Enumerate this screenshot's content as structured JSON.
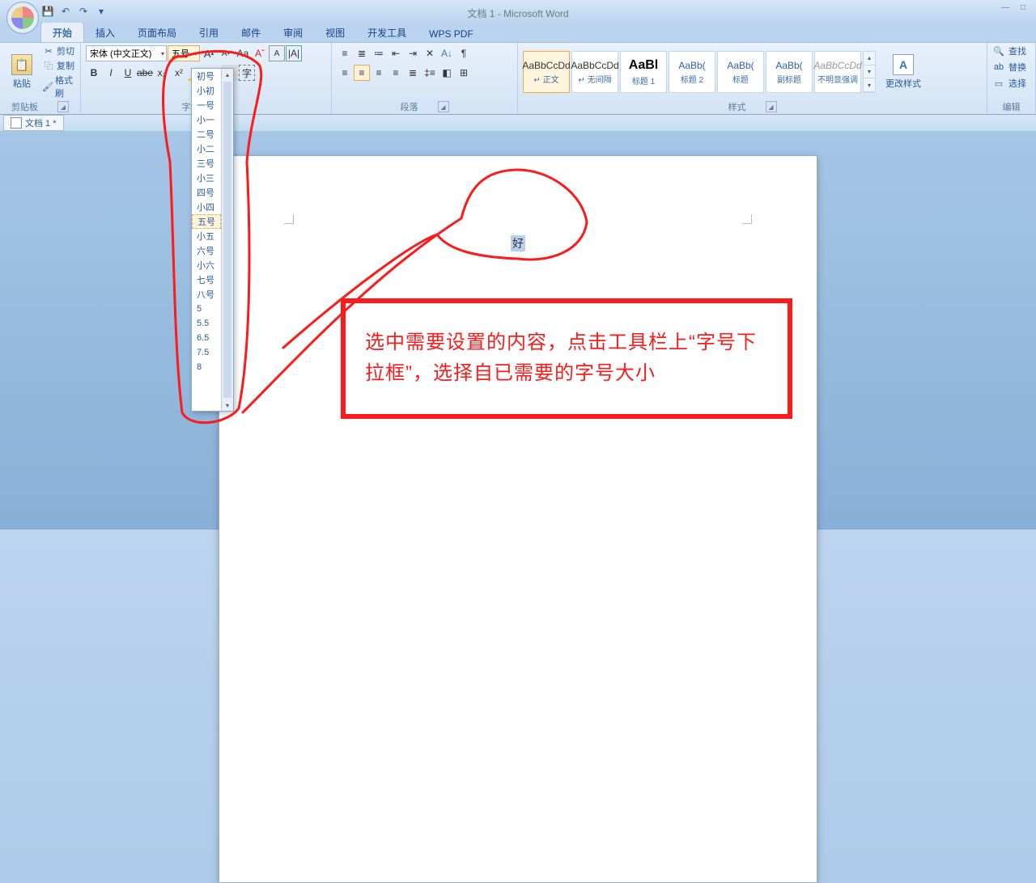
{
  "app": {
    "title": "文档 1 - Microsoft Word",
    "doctab": "文档 1 *"
  },
  "tabs": [
    "开始",
    "插入",
    "页面布局",
    "引用",
    "邮件",
    "审阅",
    "视图",
    "开发工具",
    "WPS PDF"
  ],
  "clipboard": {
    "paste": "粘贴",
    "cut": "剪切",
    "copy": "复制",
    "painter": "格式刷",
    "group": "剪贴板"
  },
  "font": {
    "name": "宋体 (中文正文)",
    "size": "五号",
    "buttons_row1": [
      "A",
      "A",
      "Aa",
      "Aˇ",
      "A",
      "|A|"
    ],
    "buttons_row2": [
      "B",
      "I",
      "U",
      "abe",
      "x₂",
      "x²",
      "A",
      "𝐀",
      "A"
    ],
    "group": "字体"
  },
  "paragraph": {
    "group": "段落"
  },
  "styles": [
    {
      "sample": "AaBbCcDd",
      "label": "↵ 正文",
      "cls": ""
    },
    {
      "sample": "AaBbCcDd",
      "label": "↵ 无间隔",
      "cls": ""
    },
    {
      "sample": "AaBl",
      "label": "标题 1",
      "cls": "big"
    },
    {
      "sample": "AaBb(",
      "label": "标题 2",
      "cls": "blue"
    },
    {
      "sample": "AaBb(",
      "label": "标题",
      "cls": "blue"
    },
    {
      "sample": "AaBb(",
      "label": "副标题",
      "cls": "blue"
    },
    {
      "sample": "AaBbCcDd",
      "label": "不明显强调",
      "cls": "grey"
    }
  ],
  "styles_group": "样式",
  "change_styles": "更改样式",
  "editing": {
    "find": "查找",
    "replace": "替换",
    "select": "选择",
    "group": "编辑"
  },
  "size_options": [
    "初号",
    "小初",
    "一号",
    "小一",
    "二号",
    "小二",
    "三号",
    "小三",
    "四号",
    "小四",
    "五号",
    "小五",
    "六号",
    "小六",
    "七号",
    "八号",
    "5",
    "5.5",
    "6.5",
    "7.5",
    "8"
  ],
  "doc_text": "好",
  "annotation": "选中需要设置的内容，点击工具栏上“字号下拉框”，选择自已需要的字号大小"
}
